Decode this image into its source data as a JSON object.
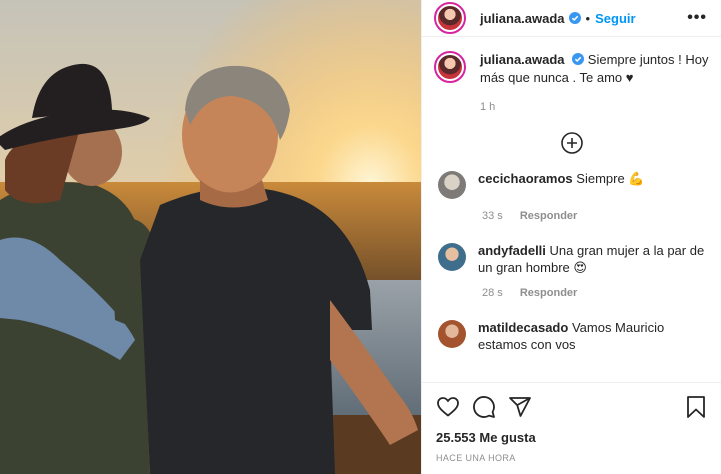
{
  "post": {
    "author": "juliana.awada",
    "follow_label": "Seguir",
    "dot": "•",
    "more_label": "•••",
    "caption_text": "Siempre juntos ! Hoy más que nunca . Te amo ♥",
    "caption_time": "1 h"
  },
  "comments": [
    {
      "user": "cecichaoramos",
      "text": "Siempre 💪",
      "time": "33 s",
      "reply": "Responder"
    },
    {
      "user": "andyfadelli",
      "text": "Una gran mujer a la par de un gran hombre 😍",
      "time": "28 s",
      "reply": "Responder"
    },
    {
      "user": "matildecasado",
      "text": "Vamos Mauricio estamos con vos"
    }
  ],
  "footer": {
    "likes": "25.553 Me gusta",
    "ago": "HACE UNA HORA"
  },
  "icons": {
    "verified": "verified-badge-icon",
    "load_more": "plus-circle-icon",
    "like": "heart-icon",
    "comment": "comment-icon",
    "share": "share-icon",
    "save": "bookmark-icon"
  },
  "colors": {
    "accent": "#0095f6",
    "muted": "#8e8e8e",
    "text": "#262626",
    "border": "#efefef"
  }
}
